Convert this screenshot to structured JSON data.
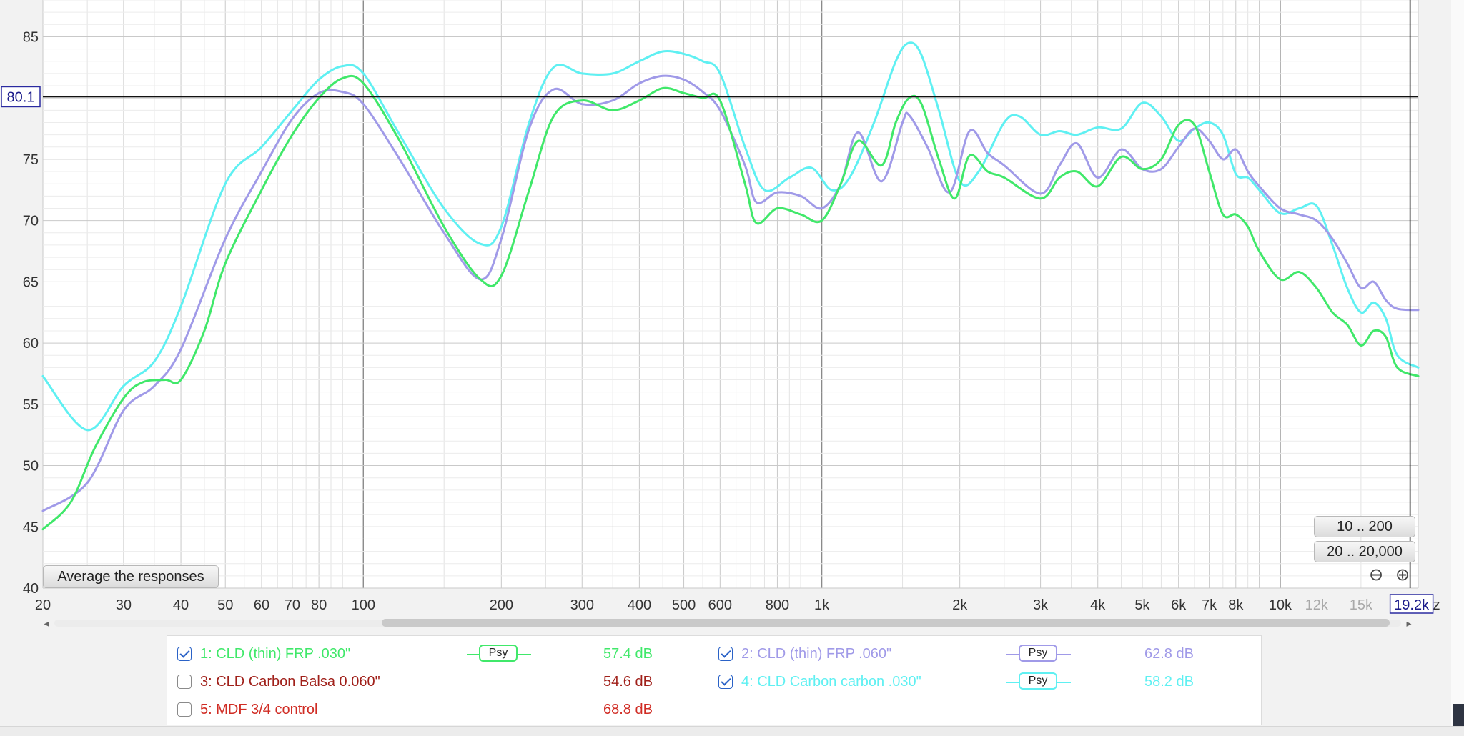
{
  "chart_data": {
    "type": "line",
    "x_scale": "log",
    "xlim": [
      20,
      20000
    ],
    "ylim": [
      40,
      88
    ],
    "y_ticks": [
      40,
      45,
      50,
      55,
      60,
      65,
      70,
      75,
      80,
      85
    ],
    "x_tick_labels": [
      {
        "f": 20,
        "label": "20"
      },
      {
        "f": 30,
        "label": "30"
      },
      {
        "f": 40,
        "label": "40"
      },
      {
        "f": 50,
        "label": "50"
      },
      {
        "f": 60,
        "label": "60"
      },
      {
        "f": 70,
        "label": "70"
      },
      {
        "f": 80,
        "label": "80"
      },
      {
        "f": 100,
        "label": "100"
      },
      {
        "f": 200,
        "label": "200"
      },
      {
        "f": 300,
        "label": "300"
      },
      {
        "f": 400,
        "label": "400"
      },
      {
        "f": 500,
        "label": "500"
      },
      {
        "f": 600,
        "label": "600"
      },
      {
        "f": 800,
        "label": "800"
      },
      {
        "f": 1000,
        "label": "1k"
      },
      {
        "f": 2000,
        "label": "2k"
      },
      {
        "f": 3000,
        "label": "3k"
      },
      {
        "f": 4000,
        "label": "4k"
      },
      {
        "f": 5000,
        "label": "5k"
      },
      {
        "f": 6000,
        "label": "6k"
      },
      {
        "f": 7000,
        "label": "7k"
      },
      {
        "f": 8000,
        "label": "8k"
      },
      {
        "f": 10000,
        "label": "10k"
      },
      {
        "f": 12000,
        "label": "12k",
        "muted": true
      },
      {
        "f": 15000,
        "label": "15k",
        "muted": true
      }
    ],
    "cursor": {
      "y": 80.1,
      "y_label": "80.1",
      "x": 19200,
      "x_label": "19.2k",
      "x_suffix": "z"
    },
    "grid": true,
    "series": [
      {
        "name": "4: CLD Carbon carbon .030\"",
        "color": "#5ff0f2",
        "points": [
          [
            20,
            57.3
          ],
          [
            25,
            52.9
          ],
          [
            30,
            56.5
          ],
          [
            35,
            58.5
          ],
          [
            40,
            63
          ],
          [
            50,
            73
          ],
          [
            60,
            76
          ],
          [
            70,
            79
          ],
          [
            80,
            81.5
          ],
          [
            90,
            82.6
          ],
          [
            100,
            82
          ],
          [
            120,
            77
          ],
          [
            150,
            71
          ],
          [
            180,
            68.1
          ],
          [
            200,
            69.5
          ],
          [
            230,
            78
          ],
          [
            260,
            82.5
          ],
          [
            300,
            82
          ],
          [
            350,
            82
          ],
          [
            400,
            83
          ],
          [
            450,
            83.8
          ],
          [
            500,
            83.6
          ],
          [
            550,
            83
          ],
          [
            600,
            82
          ],
          [
            680,
            76
          ],
          [
            750,
            72.5
          ],
          [
            850,
            73.5
          ],
          [
            950,
            74.3
          ],
          [
            1050,
            72.5
          ],
          [
            1150,
            73.5
          ],
          [
            1300,
            78
          ],
          [
            1450,
            83
          ],
          [
            1550,
            84.5
          ],
          [
            1650,
            83.5
          ],
          [
            1800,
            79
          ],
          [
            2000,
            73.2
          ],
          [
            2200,
            74
          ],
          [
            2500,
            78
          ],
          [
            2700,
            78.5
          ],
          [
            3000,
            77
          ],
          [
            3300,
            77.3
          ],
          [
            3600,
            77
          ],
          [
            4000,
            77.6
          ],
          [
            4500,
            77.5
          ],
          [
            5000,
            79.6
          ],
          [
            5500,
            78.5
          ],
          [
            6000,
            76.5
          ],
          [
            6500,
            77.5
          ],
          [
            7000,
            78
          ],
          [
            7500,
            77
          ],
          [
            8000,
            73.8
          ],
          [
            8500,
            73.5
          ],
          [
            9000,
            72.5
          ],
          [
            10000,
            70.6
          ],
          [
            11000,
            71
          ],
          [
            12000,
            71.2
          ],
          [
            13000,
            68
          ],
          [
            14000,
            64.5
          ],
          [
            15000,
            62.5
          ],
          [
            16000,
            63.3
          ],
          [
            17000,
            62
          ],
          [
            18000,
            59
          ],
          [
            20000,
            58
          ]
        ]
      },
      {
        "name": "2: CLD (thin) FRP .060\"",
        "color": "#a09ae8",
        "points": [
          [
            20,
            46.3
          ],
          [
            25,
            48.6
          ],
          [
            30,
            54.5
          ],
          [
            35,
            56.5
          ],
          [
            40,
            59.5
          ],
          [
            50,
            68.5
          ],
          [
            60,
            74
          ],
          [
            70,
            78.3
          ],
          [
            80,
            80.4
          ],
          [
            90,
            80.5
          ],
          [
            100,
            79.5
          ],
          [
            120,
            75
          ],
          [
            150,
            69
          ],
          [
            180,
            65.2
          ],
          [
            200,
            68.5
          ],
          [
            230,
            77.5
          ],
          [
            260,
            80.7
          ],
          [
            300,
            79.5
          ],
          [
            350,
            79.8
          ],
          [
            400,
            81.2
          ],
          [
            450,
            81.8
          ],
          [
            500,
            81.5
          ],
          [
            550,
            80.5
          ],
          [
            600,
            79
          ],
          [
            680,
            74.5
          ],
          [
            720,
            71.5
          ],
          [
            800,
            72.3
          ],
          [
            900,
            72
          ],
          [
            1000,
            71
          ],
          [
            1100,
            73
          ],
          [
            1200,
            77.2
          ],
          [
            1350,
            73.2
          ],
          [
            1500,
            78
          ],
          [
            1550,
            78.6
          ],
          [
            1700,
            76
          ],
          [
            1900,
            72.3
          ],
          [
            2100,
            77.3
          ],
          [
            2300,
            75.5
          ],
          [
            2500,
            74.5
          ],
          [
            3000,
            72.2
          ],
          [
            3300,
            74.5
          ],
          [
            3600,
            76.3
          ],
          [
            4000,
            73.5
          ],
          [
            4500,
            75.8
          ],
          [
            5000,
            74.2
          ],
          [
            5500,
            74.2
          ],
          [
            6000,
            76
          ],
          [
            6500,
            77.5
          ],
          [
            7000,
            76.5
          ],
          [
            7500,
            75
          ],
          [
            8000,
            75.8
          ],
          [
            8500,
            74
          ],
          [
            9000,
            72.8
          ],
          [
            10000,
            71
          ],
          [
            11000,
            70.5
          ],
          [
            12000,
            70
          ],
          [
            13000,
            68.5
          ],
          [
            14000,
            66.5
          ],
          [
            15000,
            64.5
          ],
          [
            16000,
            65
          ],
          [
            17000,
            63.5
          ],
          [
            18000,
            62.8
          ],
          [
            20000,
            62.7
          ]
        ]
      },
      {
        "name": "1: CLD (thin) FRP .030\"",
        "color": "#40e86a",
        "points": [
          [
            20,
            44.8
          ],
          [
            23,
            47
          ],
          [
            26,
            51.5
          ],
          [
            30,
            55.5
          ],
          [
            33,
            56.8
          ],
          [
            37,
            57
          ],
          [
            40,
            57
          ],
          [
            45,
            61
          ],
          [
            50,
            66.5
          ],
          [
            60,
            72.5
          ],
          [
            70,
            77
          ],
          [
            80,
            80
          ],
          [
            90,
            81.6
          ],
          [
            100,
            81.2
          ],
          [
            120,
            76.5
          ],
          [
            150,
            69.5
          ],
          [
            180,
            65.2
          ],
          [
            200,
            65.5
          ],
          [
            230,
            72.5
          ],
          [
            260,
            78.5
          ],
          [
            300,
            79.8
          ],
          [
            350,
            79
          ],
          [
            400,
            79.8
          ],
          [
            450,
            80.8
          ],
          [
            500,
            80.4
          ],
          [
            550,
            80
          ],
          [
            600,
            79.8
          ],
          [
            680,
            73
          ],
          [
            720,
            69.8
          ],
          [
            800,
            71
          ],
          [
            900,
            70.5
          ],
          [
            1000,
            70
          ],
          [
            1100,
            73
          ],
          [
            1200,
            76.5
          ],
          [
            1350,
            74.5
          ],
          [
            1450,
            78
          ],
          [
            1550,
            80
          ],
          [
            1650,
            79.5
          ],
          [
            1800,
            75
          ],
          [
            1950,
            71.8
          ],
          [
            2100,
            75.3
          ],
          [
            2300,
            74
          ],
          [
            2500,
            73.5
          ],
          [
            3000,
            71.8
          ],
          [
            3300,
            73.5
          ],
          [
            3600,
            74
          ],
          [
            4000,
            72.8
          ],
          [
            4500,
            75.2
          ],
          [
            5000,
            74.2
          ],
          [
            5500,
            75
          ],
          [
            6000,
            77.8
          ],
          [
            6500,
            77.8
          ],
          [
            7000,
            74
          ],
          [
            7500,
            70.5
          ],
          [
            8000,
            70.5
          ],
          [
            8500,
            69.5
          ],
          [
            9000,
            67.5
          ],
          [
            10000,
            65.2
          ],
          [
            11000,
            65.8
          ],
          [
            12000,
            64.5
          ],
          [
            13000,
            62.5
          ],
          [
            14000,
            61.5
          ],
          [
            15000,
            59.8
          ],
          [
            16000,
            61
          ],
          [
            17000,
            60.5
          ],
          [
            18000,
            58
          ],
          [
            20000,
            57.3
          ]
        ]
      }
    ]
  },
  "buttons": {
    "average": "Average the responses",
    "range_a": "10 .. 200",
    "range_b": "20 .. 20,000",
    "zoom_out": "⊖",
    "zoom_in": "⊕"
  },
  "scroll": {
    "left_arrow": "◂",
    "right_arrow": "▸"
  },
  "legend": {
    "entries": [
      {
        "label": "1: CLD (thin) FRP .030\"",
        "checked": true,
        "psy": "Psy",
        "db": "57.4 dB",
        "color": "#40e86a"
      },
      {
        "label": "2: CLD (thin) FRP .060\"",
        "checked": true,
        "psy": "Psy",
        "db": "62.8 dB",
        "color": "#a09ae8"
      },
      {
        "label": "3: CLD Carbon Balsa 0.060\"",
        "checked": false,
        "psy": "",
        "db": "54.6 dB",
        "color": "#a0201a"
      },
      {
        "label": "4: CLD Carbon carbon .030\"",
        "checked": true,
        "psy": "Psy",
        "db": "58.2 dB",
        "color": "#5ff0f2"
      },
      {
        "label": "5: MDF 3/4 control",
        "checked": false,
        "psy": "",
        "db": "68.8 dB",
        "color": "#d02c24"
      }
    ]
  }
}
